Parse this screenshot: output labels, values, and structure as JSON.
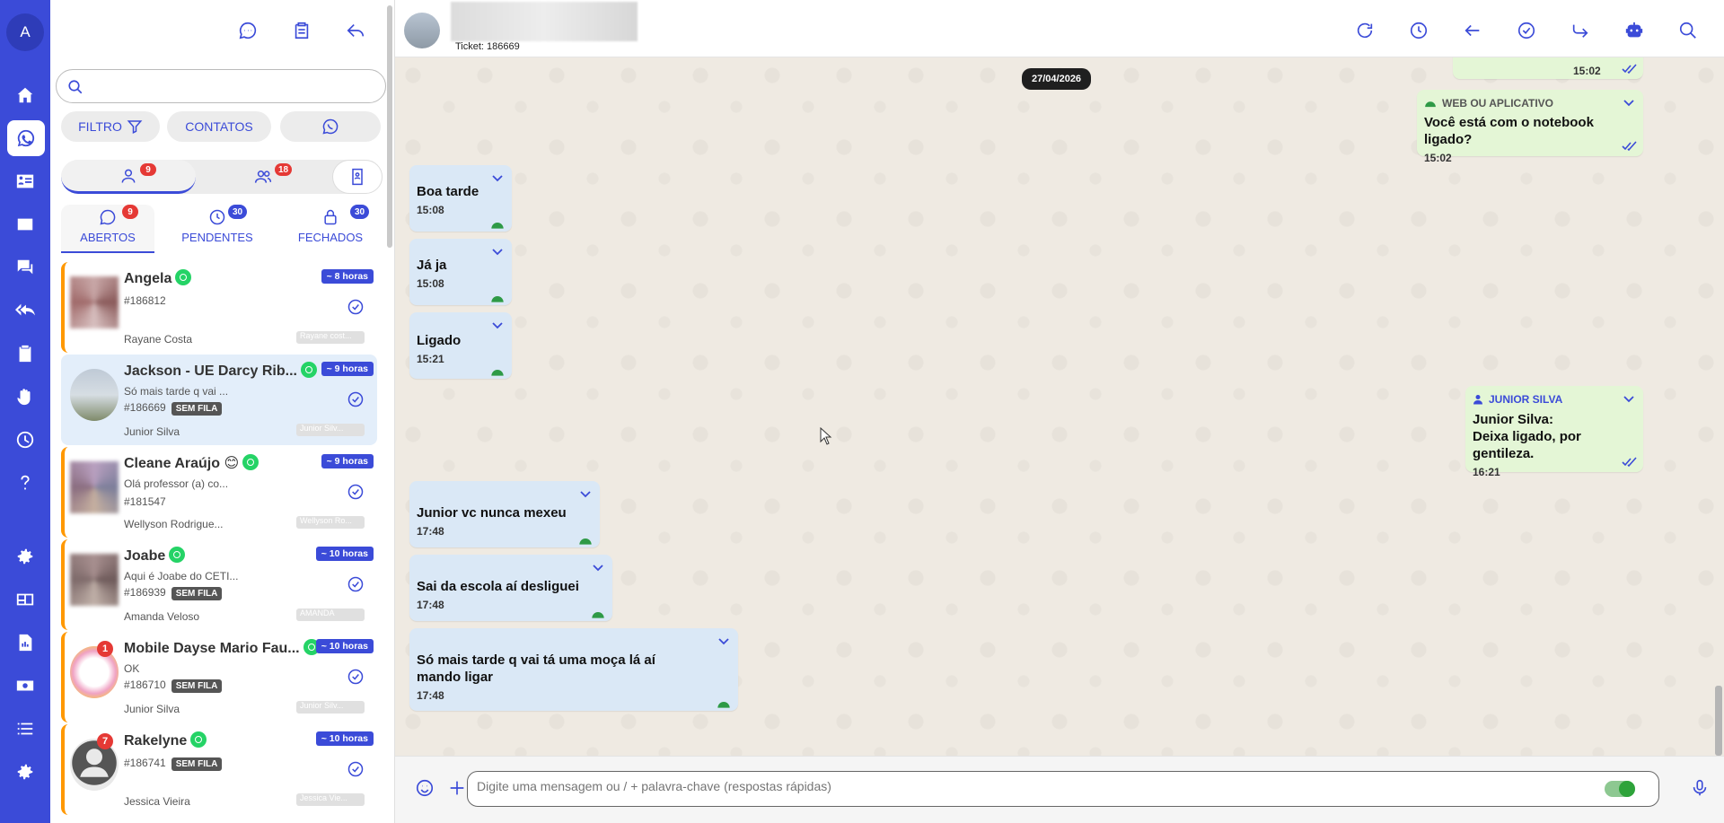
{
  "rail": {
    "avatar_letter": "A",
    "items": [
      {
        "name": "home-icon"
      },
      {
        "name": "whatsapp-icon",
        "active": true
      },
      {
        "name": "contact-card-icon"
      },
      {
        "name": "kanban-icon"
      },
      {
        "name": "chats-icon"
      },
      {
        "name": "reply-all-icon"
      },
      {
        "name": "clipboard-icon"
      },
      {
        "name": "hand-icon"
      },
      {
        "name": "clock-icon"
      },
      {
        "name": "help-icon"
      },
      {
        "name": "settings-icon"
      },
      {
        "name": "dashboard-icon"
      },
      {
        "name": "report-icon"
      },
      {
        "name": "money-icon"
      },
      {
        "name": "list-icon"
      },
      {
        "name": "gear-icon"
      }
    ]
  },
  "list": {
    "search_placeholder": "",
    "filter_label": "FILTRO",
    "contacts_label": "CONTATOS",
    "my_count": "9",
    "group_count": "18",
    "tabs": [
      {
        "label": "ABERTOS",
        "count": "9",
        "badge_color": "#e53935"
      },
      {
        "label": "PENDENTES",
        "count": "30",
        "badge_color": "#3b4bd8"
      },
      {
        "label": "FECHADOS",
        "count": "30",
        "badge_color": "#3b4bd8"
      }
    ],
    "tickets": [
      {
        "name": "Angela",
        "message": "",
        "number": "#186812",
        "tag": "",
        "agent": "Rayane Costa",
        "agent_tag": "Rayane cost...",
        "time": "~ 8 horas",
        "unread": ""
      },
      {
        "name": "Jackson - UE Darcy Rib...",
        "message": "Só mais tarde q vai ...",
        "number": "#186669",
        "tag": "SEM FILA",
        "agent": "Junior Silva",
        "agent_tag": "Junior Silv...",
        "time": "~ 9 horas",
        "unread": ""
      },
      {
        "name": "Cleane Araújo 😊",
        "message": "Olá professor (a) co...",
        "number": "#181547",
        "tag": "",
        "agent": "Wellyson Rodrigue...",
        "agent_tag": "Wellyson Ro...",
        "time": "~ 9 horas",
        "unread": ""
      },
      {
        "name": "Joabe",
        "message": "Aqui é Joabe do CETI...",
        "number": "#186939",
        "tag": "SEM FILA",
        "agent": "Amanda Veloso",
        "agent_tag": "AMANDA",
        "time": "~ 10 horas",
        "unread": ""
      },
      {
        "name": "Mobile Dayse Mario Fau...",
        "message": "OK",
        "number": "#186710",
        "tag": "SEM FILA",
        "agent": "Junior Silva",
        "agent_tag": "Junior Silv...",
        "time": "~ 10 horas",
        "unread": "1"
      },
      {
        "name": "Rakelyne",
        "message": "",
        "number": "#186741",
        "tag": "SEM FILA",
        "agent": "Jessica Vieira",
        "agent_tag": "Jessica Vie...",
        "time": "~ 10 horas",
        "unread": "7"
      }
    ]
  },
  "chat": {
    "ticket_label": "Ticket: 186669",
    "date": "27/04/2026",
    "messages": [
      {
        "dir": "out",
        "origin": "",
        "text": "",
        "time": "15:02"
      },
      {
        "dir": "out",
        "origin": "WEB OU APLICATIVO",
        "text": "Você está com o notebook ligado?",
        "time": "15:02"
      },
      {
        "dir": "in",
        "text": "Boa tarde",
        "time": "15:08"
      },
      {
        "dir": "in",
        "text": "Já ja",
        "time": "15:08"
      },
      {
        "dir": "in",
        "text": "Ligado",
        "time": "15:21"
      },
      {
        "dir": "out",
        "origin": "JUNIOR SILVA",
        "text_line1": "Junior Silva:",
        "text_line2": "Deixa ligado, por gentileza.",
        "time": "16:21"
      },
      {
        "dir": "in",
        "text": "Junior vc nunca mexeu",
        "time": "17:48"
      },
      {
        "dir": "in",
        "text": "Sai da escola aí desliguei",
        "time": "17:48"
      },
      {
        "dir": "in",
        "text_line1": "Só mais tarde q vai tá uma moça lá aí",
        "text_line2": "mando ligar",
        "time": "17:48"
      }
    ],
    "composer_placeholder": "Digite uma mensagem ou / + palavra-chave (respostas rápidas)"
  },
  "colors": {
    "accent": "#3b4bd8",
    "in_bubble": "#dae8f6",
    "out_bubble": "#e4f6d6",
    "ticket_border": "#ff9800",
    "badge_red": "#e53935"
  }
}
